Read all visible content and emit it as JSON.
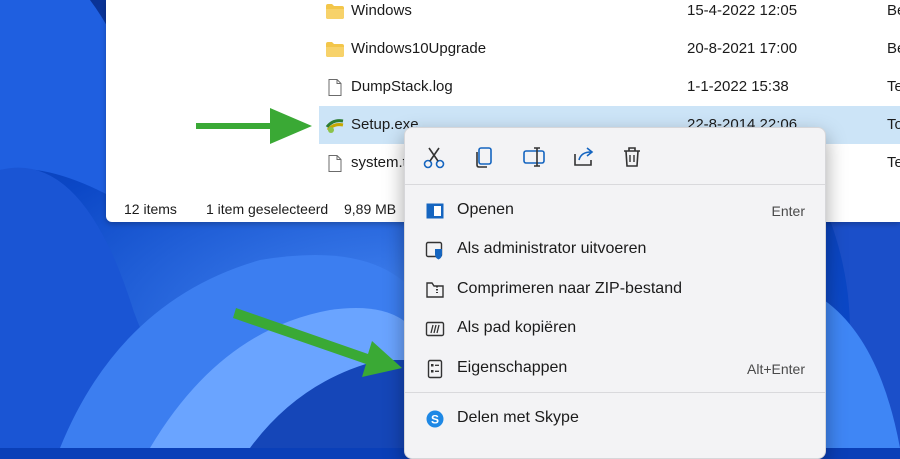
{
  "explorer": {
    "files": [
      {
        "name": "Windows",
        "date": "15-4-2022 12:05",
        "type": "Be",
        "icon": "folder-icon"
      },
      {
        "name": "Windows10Upgrade",
        "date": "20-8-2021 17:00",
        "type": "Be",
        "icon": "folder-icon"
      },
      {
        "name": "DumpStack.log",
        "date": "1-1-2022 15:38",
        "type": "Te",
        "icon": "document-icon"
      },
      {
        "name": "Setup.exe",
        "date": "22-8-2014 22:06",
        "type": "To",
        "icon": "setup-exe-icon",
        "selected": true
      },
      {
        "name": "system.t",
        "date": "",
        "type": "Te",
        "icon": "document-icon"
      }
    ],
    "status": {
      "item_count": "12 items",
      "selected": "1 item geselecteerd",
      "size": "9,89 MB"
    }
  },
  "context_menu": {
    "toolbar": [
      "cut-icon",
      "copy-icon",
      "rename-icon",
      "share-icon",
      "delete-icon"
    ],
    "items": [
      {
        "label": "Openen",
        "shortcut": "Enter",
        "icon": "open-app-icon"
      },
      {
        "label": "Als administrator uitvoeren",
        "shortcut": "",
        "icon": "admin-shield-icon"
      },
      {
        "label": "Comprimeren naar ZIP-bestand",
        "shortcut": "",
        "icon": "zip-icon"
      },
      {
        "label": "Als pad kopiëren",
        "shortcut": "",
        "icon": "copy-path-icon"
      },
      {
        "label": "Eigenschappen",
        "shortcut": "Alt+Enter",
        "icon": "properties-icon"
      },
      {
        "label": "Delen met Skype",
        "shortcut": "",
        "icon": "skype-icon"
      }
    ]
  },
  "colors": {
    "selection": "#cce4f7",
    "arrow": "#3aa935",
    "accent": "#1565c0",
    "folder": "#f3c64a"
  }
}
